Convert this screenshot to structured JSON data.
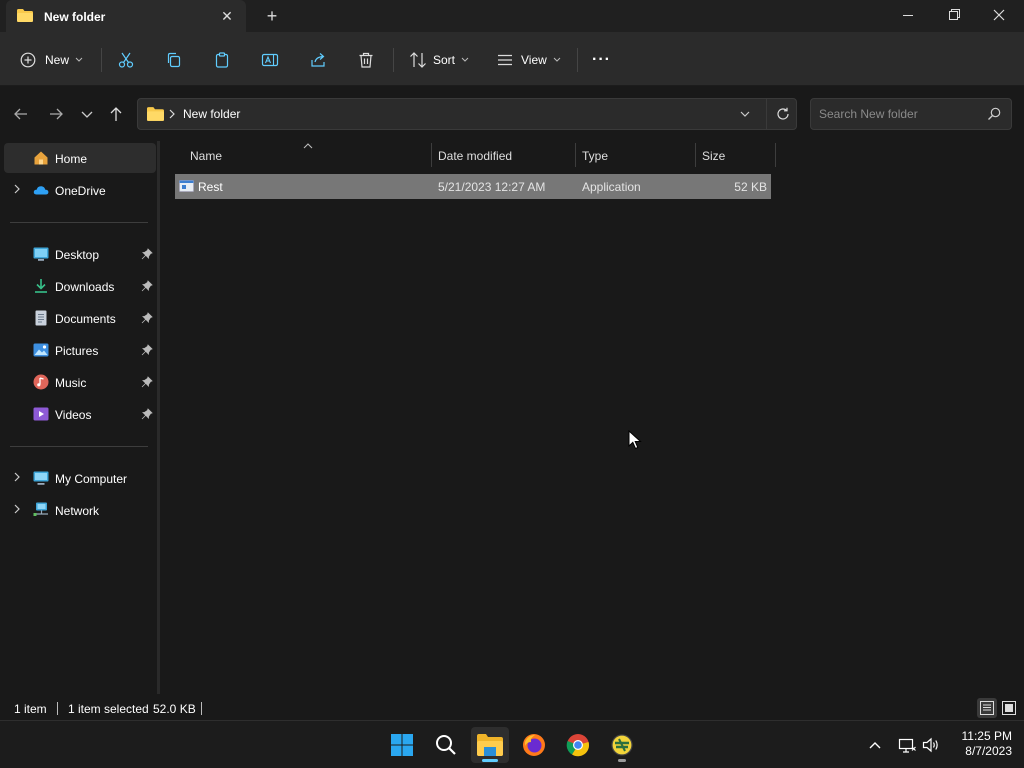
{
  "window": {
    "tab_title": "New folder",
    "tab_close": "✕",
    "new_tab": "+"
  },
  "commandbar": {
    "new_label": "New",
    "sort_label": "Sort",
    "view_label": "View",
    "more_label": "···"
  },
  "address": {
    "path": "New folder",
    "search_placeholder": "Search New folder"
  },
  "sidebar": {
    "items": [
      {
        "label": "Home",
        "icon": "home-icon"
      },
      {
        "label": "OneDrive",
        "icon": "onedrive-icon"
      },
      {
        "label": "Desktop",
        "icon": "desktop-icon"
      },
      {
        "label": "Downloads",
        "icon": "downloads-icon"
      },
      {
        "label": "Documents",
        "icon": "documents-icon"
      },
      {
        "label": "Pictures",
        "icon": "pictures-icon"
      },
      {
        "label": "Music",
        "icon": "music-icon"
      },
      {
        "label": "Videos",
        "icon": "videos-icon"
      },
      {
        "label": "My Computer",
        "icon": "computer-icon"
      },
      {
        "label": "Network",
        "icon": "network-icon"
      }
    ]
  },
  "filelist": {
    "columns": [
      "Name",
      "Date modified",
      "Type",
      "Size"
    ],
    "rows": [
      {
        "name": "Rest",
        "date": "5/21/2023 12:27 AM",
        "type": "Application",
        "size": "52 KB"
      }
    ]
  },
  "status": {
    "count": "1 item",
    "selected": "1 item selected",
    "size": "52.0 KB"
  },
  "taskbar": {
    "time": "11:25 PM",
    "date": "8/7/2023"
  },
  "colors": {
    "accent": "#60cdff",
    "folder": "#f8c94b",
    "selection": "#777777"
  }
}
